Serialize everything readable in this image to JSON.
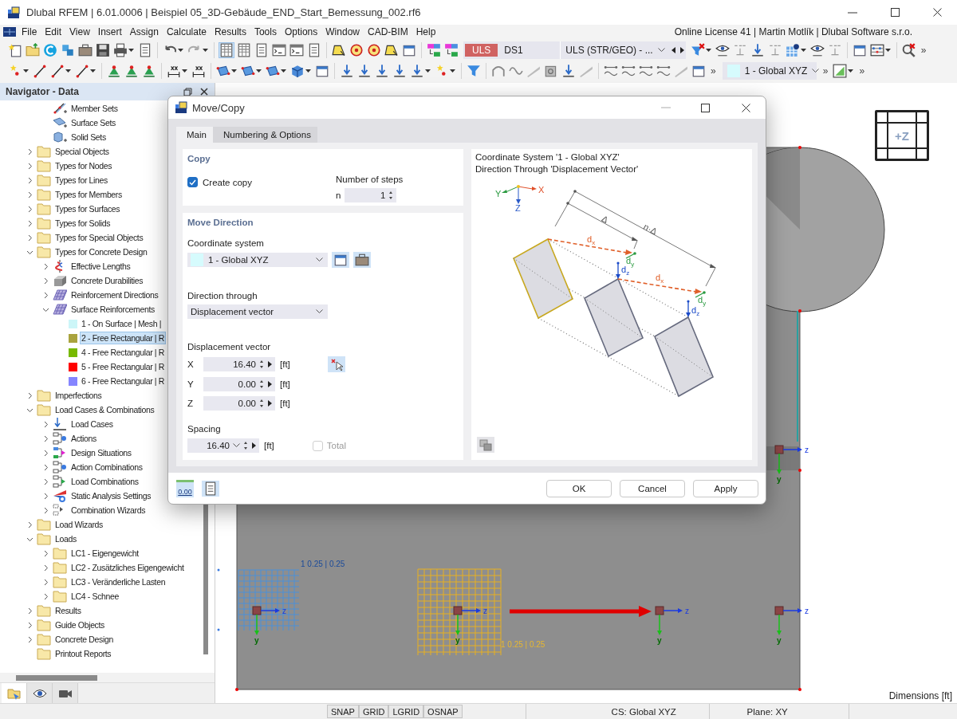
{
  "window": {
    "title": "Dlubal RFEM | 6.01.0006 | Beispiel 05_3D-Gebäude_END_Start_Bemessung_002.rf6"
  },
  "menu": {
    "items": [
      "File",
      "Edit",
      "View",
      "Insert",
      "Assign",
      "Calculate",
      "Results",
      "Tools",
      "Options",
      "Window",
      "CAD-BIM",
      "Help"
    ],
    "license": "Online License 41 | Martin Motlík | Dlubal Software s.r.o."
  },
  "toolbar_1": {
    "design_type": "ULS",
    "design_situation": "DS1",
    "combination": "ULS (STR/GEO) - ...",
    "overflow": "»"
  },
  "toolbar_2": {
    "overflow_1": "»",
    "coordinate_system": "1 - Global XYZ",
    "overflow_2": "»",
    "overflow_3": "»"
  },
  "navigator": {
    "title": "Navigator - Data",
    "tree": {
      "continued": [
        {
          "label": "Member Sets",
          "kind": "member-set"
        },
        {
          "label": "Surface Sets",
          "kind": "surface-set"
        },
        {
          "label": "Solid Sets",
          "kind": "solid-set"
        }
      ],
      "items": [
        {
          "label": "Special Objects",
          "kind": "folder",
          "expanded": false
        },
        {
          "label": "Types for Nodes",
          "kind": "folder",
          "expanded": false
        },
        {
          "label": "Types for Lines",
          "kind": "folder",
          "expanded": false
        },
        {
          "label": "Types for Members",
          "kind": "folder",
          "expanded": false
        },
        {
          "label": "Types for Surfaces",
          "kind": "folder",
          "expanded": false
        },
        {
          "label": "Types for Solids",
          "kind": "folder",
          "expanded": false
        },
        {
          "label": "Types for Special Objects",
          "kind": "folder",
          "expanded": false
        },
        {
          "label": "Types for Concrete Design",
          "kind": "folder",
          "expanded": true,
          "children": [
            {
              "label": "Effective Lengths",
              "kind": "effective-length",
              "expanded": false
            },
            {
              "label": "Concrete Durabilities",
              "kind": "durability",
              "expanded": false
            },
            {
              "label": "Reinforcement Directions",
              "kind": "reinforcement",
              "expanded": false
            },
            {
              "label": "Surface Reinforcements",
              "kind": "reinforcement",
              "expanded": true,
              "children": [
                {
                  "label": "1 - On Surface | Mesh |",
                  "color": "#ccf6f8",
                  "selected": false
                },
                {
                  "label": "2 - Free Rectangular | R",
                  "color": "#a9a33e",
                  "selected": true
                },
                {
                  "label": "4 - Free Rectangular | R",
                  "color": "#77b900",
                  "selected": false
                },
                {
                  "label": "5 - Free Rectangular | R",
                  "color": "#ff0000",
                  "selected": false
                },
                {
                  "label": "6 - Free Rectangular | R",
                  "color": "#8585ff",
                  "selected": false
                }
              ]
            }
          ]
        },
        {
          "label": "Imperfections",
          "kind": "folder",
          "expanded": false
        },
        {
          "label": "Load Cases & Combinations",
          "kind": "folder",
          "expanded": true,
          "children": [
            {
              "label": "Load Cases",
              "kind": "load-case",
              "expanded": false
            },
            {
              "label": "Actions",
              "kind": "action",
              "expanded": false
            },
            {
              "label": "Design Situations",
              "kind": "design-situation",
              "expanded": false
            },
            {
              "label": "Action Combinations",
              "kind": "action",
              "expanded": false
            },
            {
              "label": "Load Combinations",
              "kind": "load-combination",
              "expanded": false
            },
            {
              "label": "Static Analysis Settings",
              "kind": "static-settings",
              "expanded": false
            },
            {
              "label": "Combination Wizards",
              "kind": "wizard",
              "expanded": false
            }
          ]
        },
        {
          "label": "Load Wizards",
          "kind": "folder",
          "expanded": false
        },
        {
          "label": "Loads",
          "kind": "folder",
          "expanded": true,
          "children": [
            {
              "label": "LC1 - Eigengewicht",
              "kind": "folder",
              "expanded": false
            },
            {
              "label": "LC2 - Zusätzliches Eigengewicht",
              "kind": "folder",
              "expanded": false
            },
            {
              "label": "LC3 - Veränderliche Lasten",
              "kind": "folder",
              "expanded": false
            },
            {
              "label": "LC4 - Schnee",
              "kind": "folder",
              "expanded": false
            }
          ]
        },
        {
          "label": "Results",
          "kind": "folder",
          "expanded": false
        },
        {
          "label": "Guide Objects",
          "kind": "folder",
          "expanded": false
        },
        {
          "label": "Concrete Design",
          "kind": "folder",
          "expanded": false
        },
        {
          "label": "Printout Reports",
          "kind": "folder"
        }
      ]
    },
    "tabs": [
      {
        "kind": "data",
        "selected": true
      },
      {
        "kind": "view",
        "selected": false
      },
      {
        "kind": "camera",
        "selected": false
      }
    ]
  },
  "viewport": {
    "view_cube": "+Z",
    "mesh_labels": [
      "1 0.25 | 0.25",
      "1 0.25 | 0.25"
    ],
    "nodes": [
      {
        "axis_1": "z",
        "axis_2": "y"
      },
      {
        "axis_1": "z",
        "axis_2": "y"
      },
      {
        "axis_1": "z",
        "axis_2": "y"
      },
      {
        "axis_1": "z",
        "axis_2": "y"
      },
      {
        "axis_1": "z",
        "axis_2": "y"
      }
    ],
    "dimensions": "Dimensions [ft]"
  },
  "dialog": {
    "title": "Move/Copy",
    "tabs": [
      {
        "label": "Main",
        "selected": true
      },
      {
        "label": "Numbering & Options",
        "selected": false
      }
    ],
    "copy": {
      "heading": "Copy",
      "create_copy": {
        "label": "Create copy",
        "checked": true
      },
      "steps_label": "Number of steps",
      "steps_symbol": "n",
      "steps_value": "1"
    },
    "move_direction": {
      "heading": "Move Direction",
      "coordinate_system_label": "Coordinate system",
      "coordinate_system": "1 - Global XYZ",
      "direction_label": "Direction through",
      "direction": "Displacement vector",
      "vector_label": "Displacement vector",
      "vector": [
        {
          "axis": "X",
          "value": "16.40",
          "unit": "[ft]"
        },
        {
          "axis": "Y",
          "value": "0.00",
          "unit": "[ft]"
        },
        {
          "axis": "Z",
          "value": "0.00",
          "unit": "[ft]"
        }
      ],
      "spacing_label": "Spacing",
      "spacing_value": "16.40",
      "spacing_unit": "[ft]",
      "total": {
        "label": "Total",
        "checked": false,
        "disabled": true
      }
    },
    "diagram": {
      "lines": [
        "Coordinate System '1 - Global XYZ'",
        "Direction Through 'Displacement Vector'"
      ],
      "axes": [
        "X",
        "Y",
        "Z"
      ],
      "dimension_labels": [
        "Δ",
        "n·Δ"
      ],
      "offsets": [
        {
          "dx": {
            "base": "d",
            "sub": "x"
          },
          "dy": {
            "base": "d",
            "sub": "y"
          },
          "dz": {
            "base": "d",
            "sub": "z"
          }
        },
        {
          "dx": {
            "base": "d",
            "sub": "x"
          },
          "dy": {
            "base": "d",
            "sub": "y"
          },
          "dz": {
            "base": "d",
            "sub": "z"
          }
        }
      ]
    },
    "decimals_button": "0.00",
    "buttons": [
      "OK",
      "Cancel",
      "Apply"
    ]
  },
  "status_bar": {
    "toggles": [
      "SNAP",
      "GRID",
      "LGRID",
      "OSNAP"
    ],
    "cs": "CS: Global XYZ",
    "plane": "Plane: XY"
  }
}
